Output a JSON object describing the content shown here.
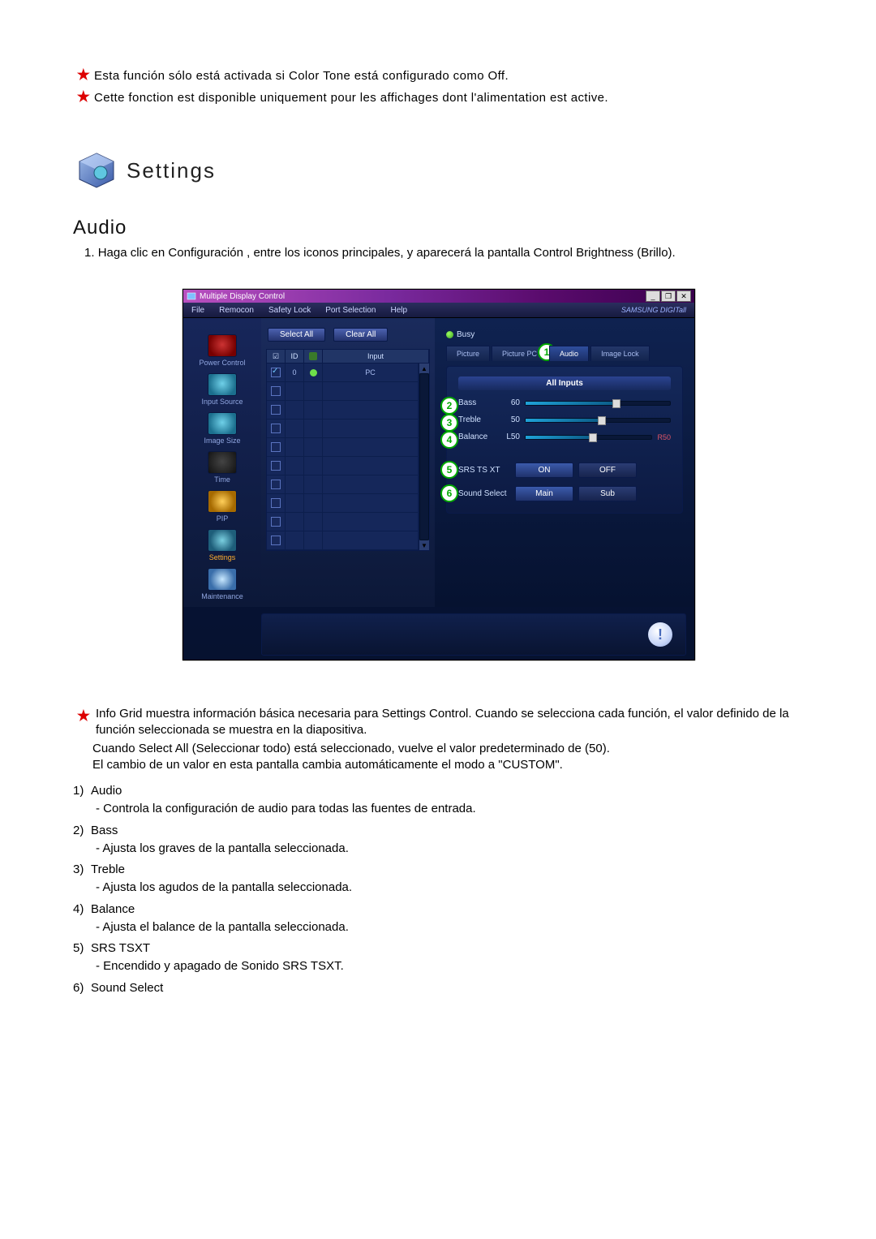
{
  "notes": {
    "line1": "Esta función sólo está activada si Color Tone está configurado como Off.",
    "line2": "Cette fonction est disponible uniquement pour les affichages dont l'alimentation est active."
  },
  "settings_heading": "Settings",
  "audio_heading": "Audio",
  "lead_num": "1.",
  "lead_text": "Haga clic en Configuración , entre los iconos principales, y aparecerá la pantalla Control Brightness (Brillo).",
  "app": {
    "title": "Multiple Display Control",
    "menu": {
      "file": "File",
      "remocon": "Remocon",
      "safety": "Safety Lock",
      "port": "Port Selection",
      "help": "Help"
    },
    "logo": "SAMSUNG DIGITall",
    "win": {
      "min": "_",
      "max": "❐",
      "close": "✕"
    },
    "toolbar": {
      "select_all": "Select All",
      "clear_all": "Clear All",
      "busy": "Busy"
    },
    "grid": {
      "h1": "☑",
      "h2": "ID",
      "h4": "Input",
      "row0": {
        "id": "0",
        "input": "PC"
      }
    },
    "sidebar": {
      "power": "Power Control",
      "input": "Input Source",
      "image": "Image Size",
      "time": "Time",
      "pip": "PIP",
      "settings": "Settings",
      "maint": "Maintenance"
    },
    "tabs": {
      "picture": "Picture",
      "picture_pc": "Picture PC",
      "audio": "Audio",
      "image_lock": "Image Lock"
    },
    "panel": {
      "head": "All Inputs",
      "bass": {
        "label": "Bass",
        "value": "60"
      },
      "treble": {
        "label": "Treble",
        "value": "50"
      },
      "balance": {
        "label": "Balance",
        "left": "L50",
        "right": "R50"
      },
      "srs": {
        "label": "SRS TS XT",
        "on": "ON",
        "off": "OFF"
      },
      "sound": {
        "label": "Sound Select",
        "main": "Main",
        "sub": "Sub"
      }
    },
    "callouts": {
      "c1": "1",
      "c2": "2",
      "c3": "3",
      "c4": "4",
      "c5": "5",
      "c6": "6"
    },
    "warn": "!"
  },
  "desc": {
    "p1": "Info Grid muestra información básica necesaria para Settings Control. Cuando se selecciona cada función, el valor definido de la función seleccionada se muestra en la diapositiva.",
    "p2": "Cuando Select All (Seleccionar todo) está seleccionado, vuelve el valor predeterminado de (50).",
    "p3": "El cambio de un valor en esta pantalla cambia automáticamente el modo a \"CUSTOM\".",
    "items": [
      {
        "num": "1)",
        "title": "Audio",
        "sub": "- Controla la configuración de audio para todas las fuentes de entrada."
      },
      {
        "num": "2)",
        "title": "Bass",
        "sub": "- Ajusta los graves de la pantalla seleccionada."
      },
      {
        "num": "3)",
        "title": "Treble",
        "sub": "- Ajusta los agudos de la pantalla seleccionada."
      },
      {
        "num": "4)",
        "title": "Balance",
        "sub": "- Ajusta el balance de la pantalla seleccionada."
      },
      {
        "num": "5)",
        "title": "SRS TSXT",
        "sub": "- Encendido y apagado de Sonido SRS TSXT."
      },
      {
        "num": "6)",
        "title": "Sound Select",
        "sub": ""
      }
    ]
  }
}
